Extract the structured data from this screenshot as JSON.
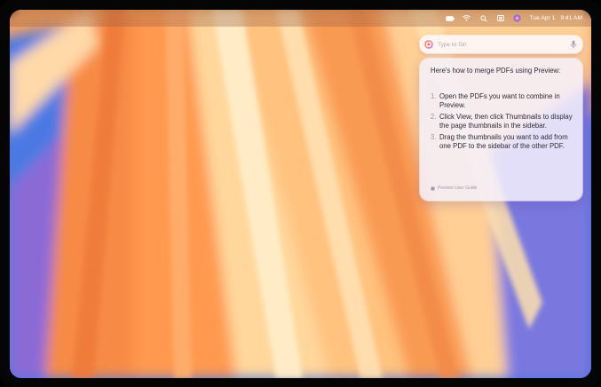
{
  "menubar": {
    "icons": [
      "battery-icon",
      "wifi-icon",
      "search-icon",
      "control-center-icon",
      "siri-icon"
    ],
    "date": "Tue Apr 1",
    "time": "9:41 AM"
  },
  "siri": {
    "placeholder": "Type to Siri"
  },
  "answer": {
    "title": "Here's how to merge PDFs using Preview:",
    "steps": [
      {
        "num": "1.",
        "text": "Open the PDFs you want to combine in Preview."
      },
      {
        "num": "2.",
        "text": "Click View, then click Thumbnails to display the page thumbnails in the sidebar."
      },
      {
        "num": "3.",
        "text": "Drag the thumbnails you want to add from one PDF to the sidebar of the other PDF."
      }
    ],
    "source": "Preview User Guide"
  },
  "colors": {
    "wallpaper_blue": "#3f6fd8",
    "wallpaper_orange": "#f98a3c",
    "wallpaper_cream": "#ffe6b0",
    "wallpaper_purple": "#8e6ad8"
  }
}
